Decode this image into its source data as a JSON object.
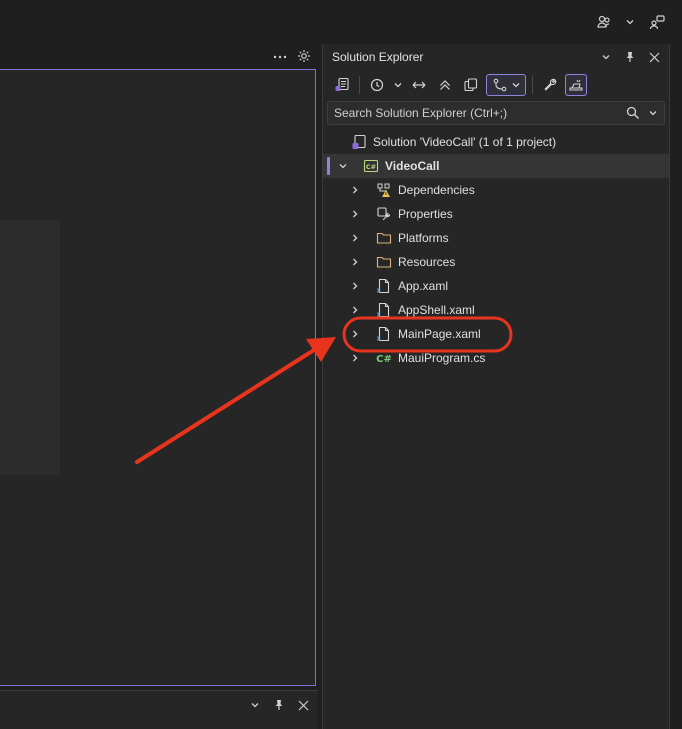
{
  "solution_explorer": {
    "title": "Solution Explorer",
    "search_placeholder": "Search Solution Explorer (Ctrl+;)",
    "solution_label": "Solution 'VideoCall' (1 of 1 project)",
    "project": {
      "name": "VideoCall",
      "items": [
        {
          "label": "Dependencies",
          "icon": "dependencies-warning-icon"
        },
        {
          "label": "Properties",
          "icon": "properties-wrench-icon"
        },
        {
          "label": "Platforms",
          "icon": "folder-icon"
        },
        {
          "label": "Resources",
          "icon": "folder-icon"
        },
        {
          "label": "App.xaml",
          "icon": "xaml-file-icon"
        },
        {
          "label": "AppShell.xaml",
          "icon": "xaml-file-icon"
        },
        {
          "label": "MainPage.xaml",
          "icon": "xaml-file-icon"
        },
        {
          "label": "MauiProgram.cs",
          "icon": "csharp-file-icon"
        }
      ]
    }
  },
  "colors": {
    "accent": "#8c84e0",
    "annotation": "#e8341c",
    "background": "#1f1f1f",
    "panel": "#262626"
  }
}
